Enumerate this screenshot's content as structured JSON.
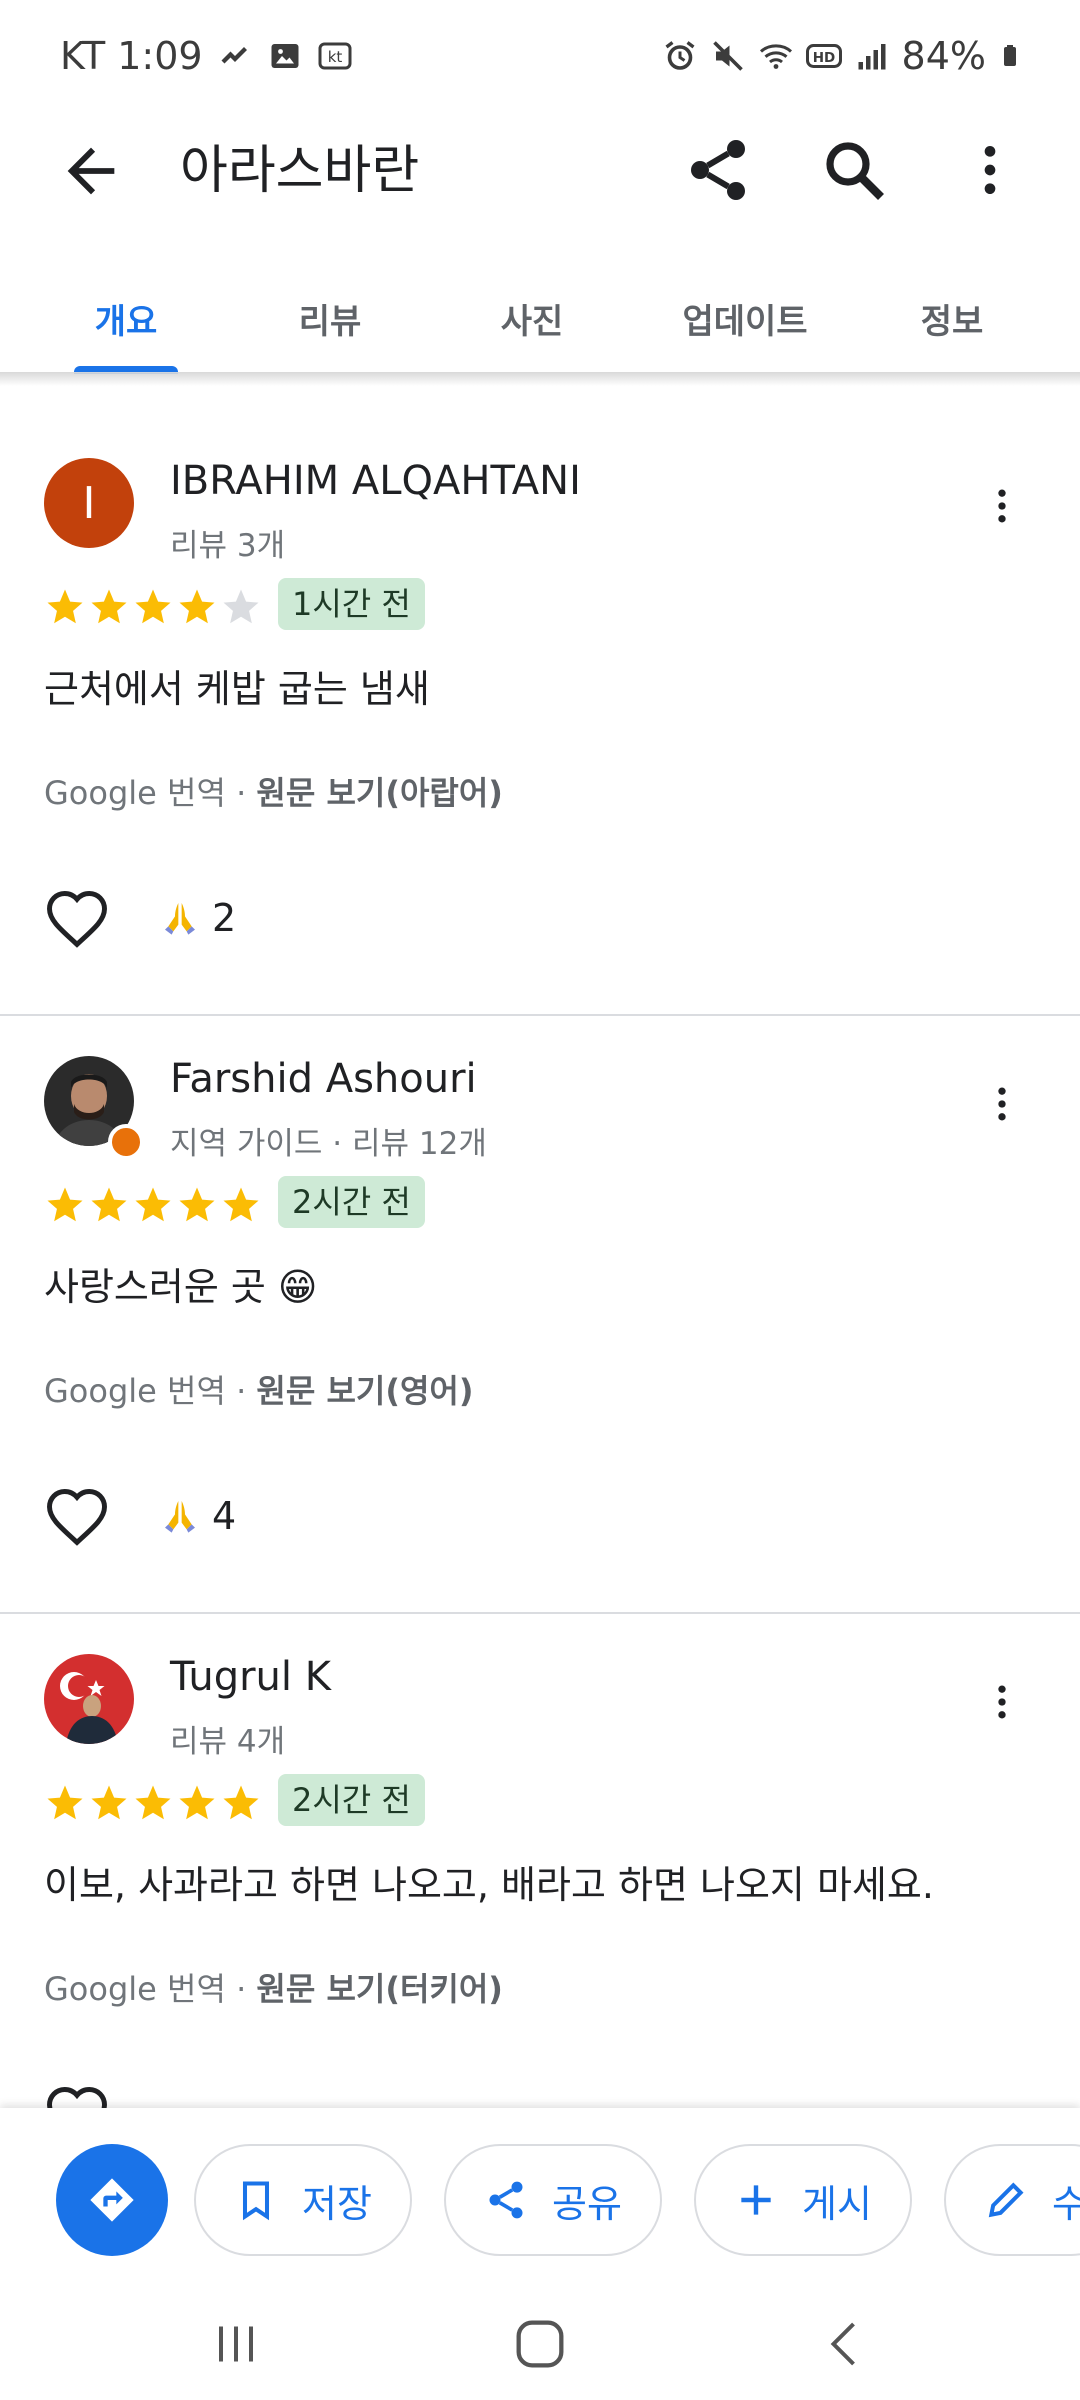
{
  "status_bar": {
    "carrier_time": "KT 1:09",
    "battery": "84%",
    "icons_left": [
      "tools-icon",
      "image-icon",
      "kt-icon"
    ],
    "icons_right": [
      "alarm-icon",
      "mute-icon",
      "wifi-icon",
      "hd-icon",
      "signal-icon",
      "battery-icon"
    ]
  },
  "app_bar": {
    "title": "아라스바란"
  },
  "tabs": [
    {
      "label": "개요",
      "active": true
    },
    {
      "label": "리뷰",
      "active": false
    },
    {
      "label": "사진",
      "active": false
    },
    {
      "label": "업데이트",
      "active": false
    },
    {
      "label": "정보",
      "active": false
    }
  ],
  "reviews": [
    {
      "name": "IBRAHIM ALQAHTANI",
      "avatar_letter": "I",
      "meta": "리뷰 3개",
      "rating": 4,
      "time": "1시간 전",
      "text": "근처에서 케밥 굽는 냄새",
      "translate_prefix": "Google 번역 · ",
      "translate_link": "원문 보기(아랍어)",
      "reaction_count": "2"
    },
    {
      "name": "Farshid Ashouri",
      "avatar_letter": "",
      "meta": "지역 가이드 · 리뷰 12개",
      "rating": 5,
      "time": "2시간 전",
      "text": "사랑스러운 곳 😁",
      "translate_prefix": "Google 번역 · ",
      "translate_link": "원문 보기(영어)",
      "reaction_count": "4"
    },
    {
      "name": "Tugrul K",
      "avatar_letter": "",
      "meta": "리뷰 4개",
      "rating": 5,
      "time": "2시간 전",
      "text": "이보, 사과라고 하면 나오고, 배라고 하면 나오지 마세요.",
      "translate_prefix": "Google 번역 · ",
      "translate_link": "원문 보기(터키어)",
      "reaction_count": ""
    }
  ],
  "actions": {
    "save_label": "저장",
    "share_label": "공유",
    "post_label": "게시",
    "edit_label": "수"
  },
  "colors": {
    "accent": "#1a73e8",
    "star": "#fbbc04",
    "star_empty": "#dadce0",
    "time_badge_bg": "#ceead6",
    "avatar_ibrahim": "#c2410c"
  }
}
